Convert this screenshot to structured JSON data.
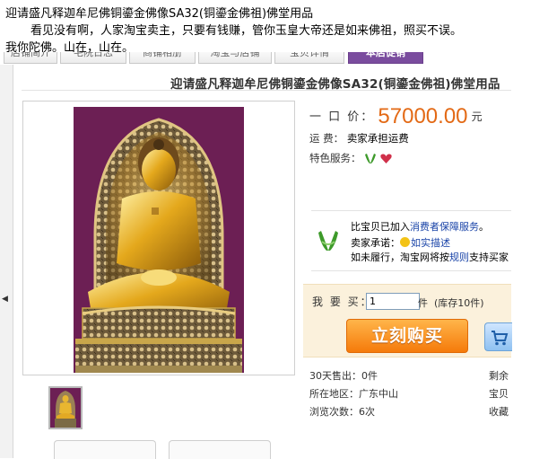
{
  "intro": {
    "line1": "迎请盛凡释迦牟尼佛铜鎏金佛像SA32(铜鎏金佛祖)佛堂用品",
    "line2": "看见没有啊，人家淘宝卖主，只要有钱赚，管你玉皇大帝还是如来佛祖，照买不误。",
    "line3": "我你陀佛。山在，山在。"
  },
  "tabs": [
    "店铺简介",
    "宅院日志",
    "商铺相册",
    "淘宝与店铺",
    "宝贝详情",
    "本店促销"
  ],
  "product": {
    "title": "迎请盛凡释迦牟尼佛铜鎏金佛像SA32(铜鎏金佛祖)佛堂用品",
    "price_label": "一 口 价：",
    "price": "57000.00",
    "price_unit": "元",
    "shipping_label": "运      费：",
    "shipping_value": "卖家承担运费",
    "service_label": "特色服务：",
    "service_icons": [
      "hands-icon",
      "heart-icon"
    ]
  },
  "guarantee": {
    "line1_prefix": "比宝贝已加入",
    "line1_link": "消费者保障服务",
    "line1_suffix": "。",
    "line2_prefix": "卖家承诺：",
    "line2_link": "如实描述",
    "line3_prefix": "如未履行，淘宝网将按",
    "line3_link": "规则",
    "line3_suffix": "支持买家"
  },
  "buy": {
    "qty_label": "我 要 买：",
    "qty_value": "1",
    "qty_unit": "件",
    "stock": "(库存10件)",
    "buy_label": "立刻购买",
    "cart_icon": "cart-icon"
  },
  "stats": {
    "sold_label": "30天售出：",
    "sold_value": "0件",
    "location_label": "所在地区：",
    "location_value": "广东中山",
    "views_label": "浏览次数：",
    "views_value": "6次",
    "right1": "剩余",
    "right2": "宝贝",
    "right3": "收藏"
  },
  "colors": {
    "price": "#e36a16",
    "link": "#1a44a8",
    "active_tab": "#7a4c9e",
    "buy_button": "#f57a0a",
    "buybox_bg": "#fbf1dc"
  }
}
